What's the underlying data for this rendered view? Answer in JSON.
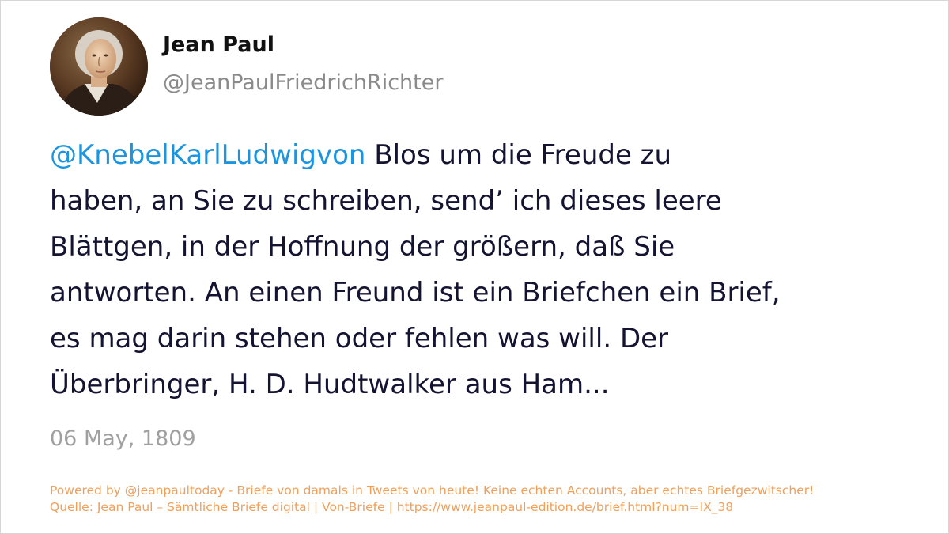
{
  "author": {
    "display_name": "Jean Paul",
    "handle": "@JeanPaulFriedrichRichter",
    "avatar_icon": "portrait-avatar"
  },
  "tweet": {
    "mention": "@KnebelKarlLudwigvon",
    "lines": [
      " Blos um die Freude zu",
      "haben, an Sie zu schreiben, send’ ich dieses leere",
      "Blättgen, in der Hoffnung der größern, daß Sie",
      "antworten. An einen Freund ist ein Briefchen ein Brief,",
      "es mag darin stehen oder fehlen was will. Der",
      "Überbringer, H. D. Hudtwalker aus Ham..."
    ],
    "date": "06 May, 1809"
  },
  "footer": {
    "powered_by": "Powered by @jeanpaultoday - Briefe von damals in Tweets von heute! Keine echten Accounts, aber echtes Briefgezwitscher!",
    "source": "Quelle: Jean Paul – Sämtliche Briefe digital | Von-Briefe | https://www.jeanpaul-edition.de/brief.html?num=IX_38"
  },
  "colors": {
    "mention": "#1b95e0",
    "text": "#141432",
    "muted": "#8a8a8a",
    "footer": "#f0a05a"
  }
}
